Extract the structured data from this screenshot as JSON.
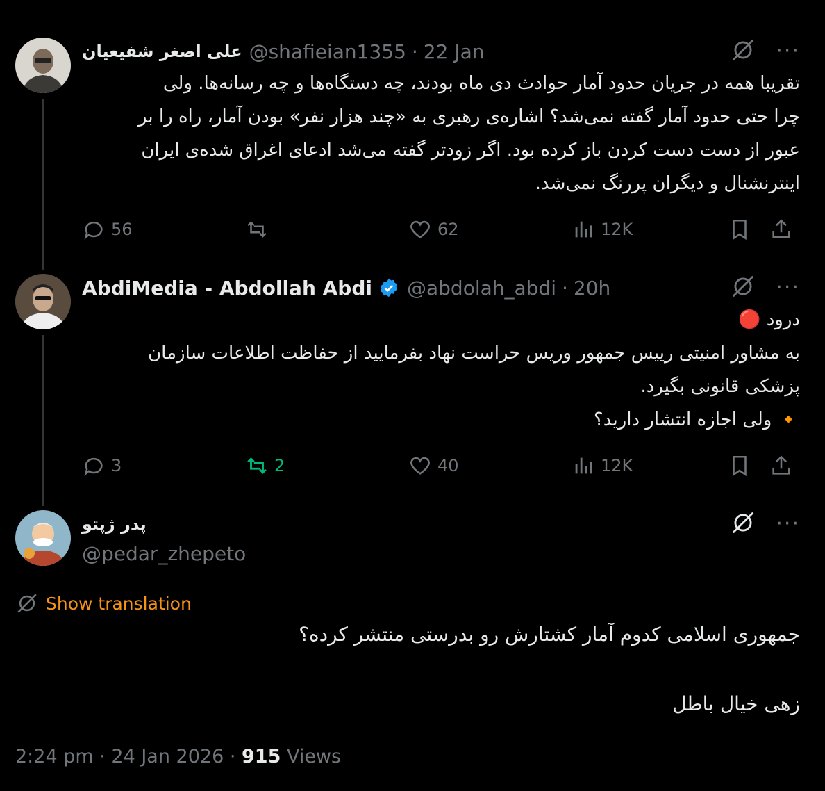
{
  "tweets": [
    {
      "name": "علی اصغر شفیعیان",
      "handle": "@shafieian1355",
      "sep": "·",
      "time": "22 Jan",
      "lines": [
        "تقریبا همه در جریان حدود آمار حوادث دی ماه بودند، چه دستگاه‌ها و چه رسانه‌ها. ولی",
        "چرا حتی حدود آمار گفته نمی‌شد؟ اشاره‌ی رهبری به «چند هزار نفر» بودن آمار، راه را بر",
        "عبور از دست دست کردن باز کرده بود. اگر زودتر گفته می‌شد ادعای اغراق شده‌ی ایران",
        "اینترنشنال و دیگران پررنگ نمی‌شد."
      ],
      "replies": "56",
      "retweets": "",
      "likes": "62",
      "views": "12K"
    },
    {
      "name": "AbdiMedia - Abdollah Abdi",
      "handle": "@abdolah_abdi",
      "sep": "·",
      "time": "20h",
      "lines": [
        "درود 🔴",
        "به مشاور امنیتی رییس جمهور وریس حراست نهاد بفرمایید از حفاظت اطلاعات سازمان",
        "پزشکی قانونی بگیرد.",
        "🔸 ولی اجازه انتشار دارید؟"
      ],
      "replies": "3",
      "retweets": "2",
      "likes": "40",
      "views": "12K",
      "verified_color": "#1d9bf0",
      "retweet_color": "#00ba7c"
    },
    {
      "name": "پدر ژپتو",
      "handle": "@pedar_zhepeto",
      "show_translation": "Show translation",
      "translation_color": "#f7931a",
      "lines": [
        "جمهوری اسلامی کدوم آمار کشتارش رو بدرستی منتشر کرده؟",
        "",
        "زهی خیال باطل"
      ],
      "timestamp": "2:24 pm · 24 Jan 2026 · ",
      "views_count": "915",
      "views_label": " Views"
    }
  ],
  "more_label": "···"
}
